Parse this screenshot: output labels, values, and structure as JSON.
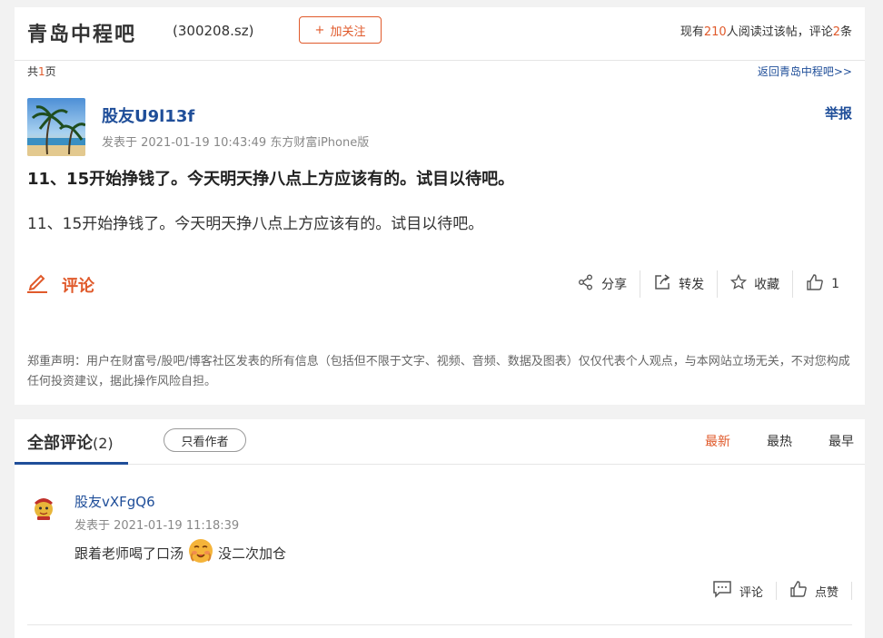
{
  "header": {
    "forum_name": "青岛中程吧",
    "stock_code": "(300208.sz)",
    "follow_label": "加关注",
    "readers_prefix": "现有",
    "readers_count": "210",
    "readers_middle": "人阅读过该帖，评论",
    "comments_count": "2",
    "readers_suffix": "条"
  },
  "pager": {
    "prefix": "共",
    "count": "1",
    "suffix": "页",
    "back_link": "返回青岛中程吧>>"
  },
  "post": {
    "author": "股友U9l13f",
    "meta": "发表于 2021-01-19 10:43:49 东方财富iPhone版",
    "report_label": "举报",
    "title": "11、15开始挣钱了。今天明天挣八点上方应该有的。试目以待吧。",
    "body": "11、15开始挣钱了。今天明天挣八点上方应该有的。试目以待吧。",
    "comment_label": "评论",
    "share_label": "分享",
    "forward_label": "转发",
    "favorite_label": "收藏",
    "like_count": "1",
    "disclaimer": "郑重声明：用户在财富号/股吧/博客社区发表的所有信息（包括但不限于文字、视频、音频、数据及图表）仅仅代表个人观点，与本网站立场无关，不对您构成任何投资建议，据此操作风险自担。"
  },
  "comments_section": {
    "tab_label": "全部评论",
    "tab_count": "(2)",
    "author_only_label": "只看作者",
    "sort_options": [
      "最新",
      "最热",
      "最早"
    ],
    "items": [
      {
        "author": "股友vXFgQ6",
        "meta": "发表于 2021-01-19 11:18:39",
        "text_before": "跟着老师喝了口汤",
        "emoji": "😋",
        "text_after": "没二次加仓",
        "reply_label": "评论",
        "like_label": "点赞"
      }
    ]
  },
  "colors": {
    "accent": "#e05a2b",
    "link": "#1f4e99"
  }
}
